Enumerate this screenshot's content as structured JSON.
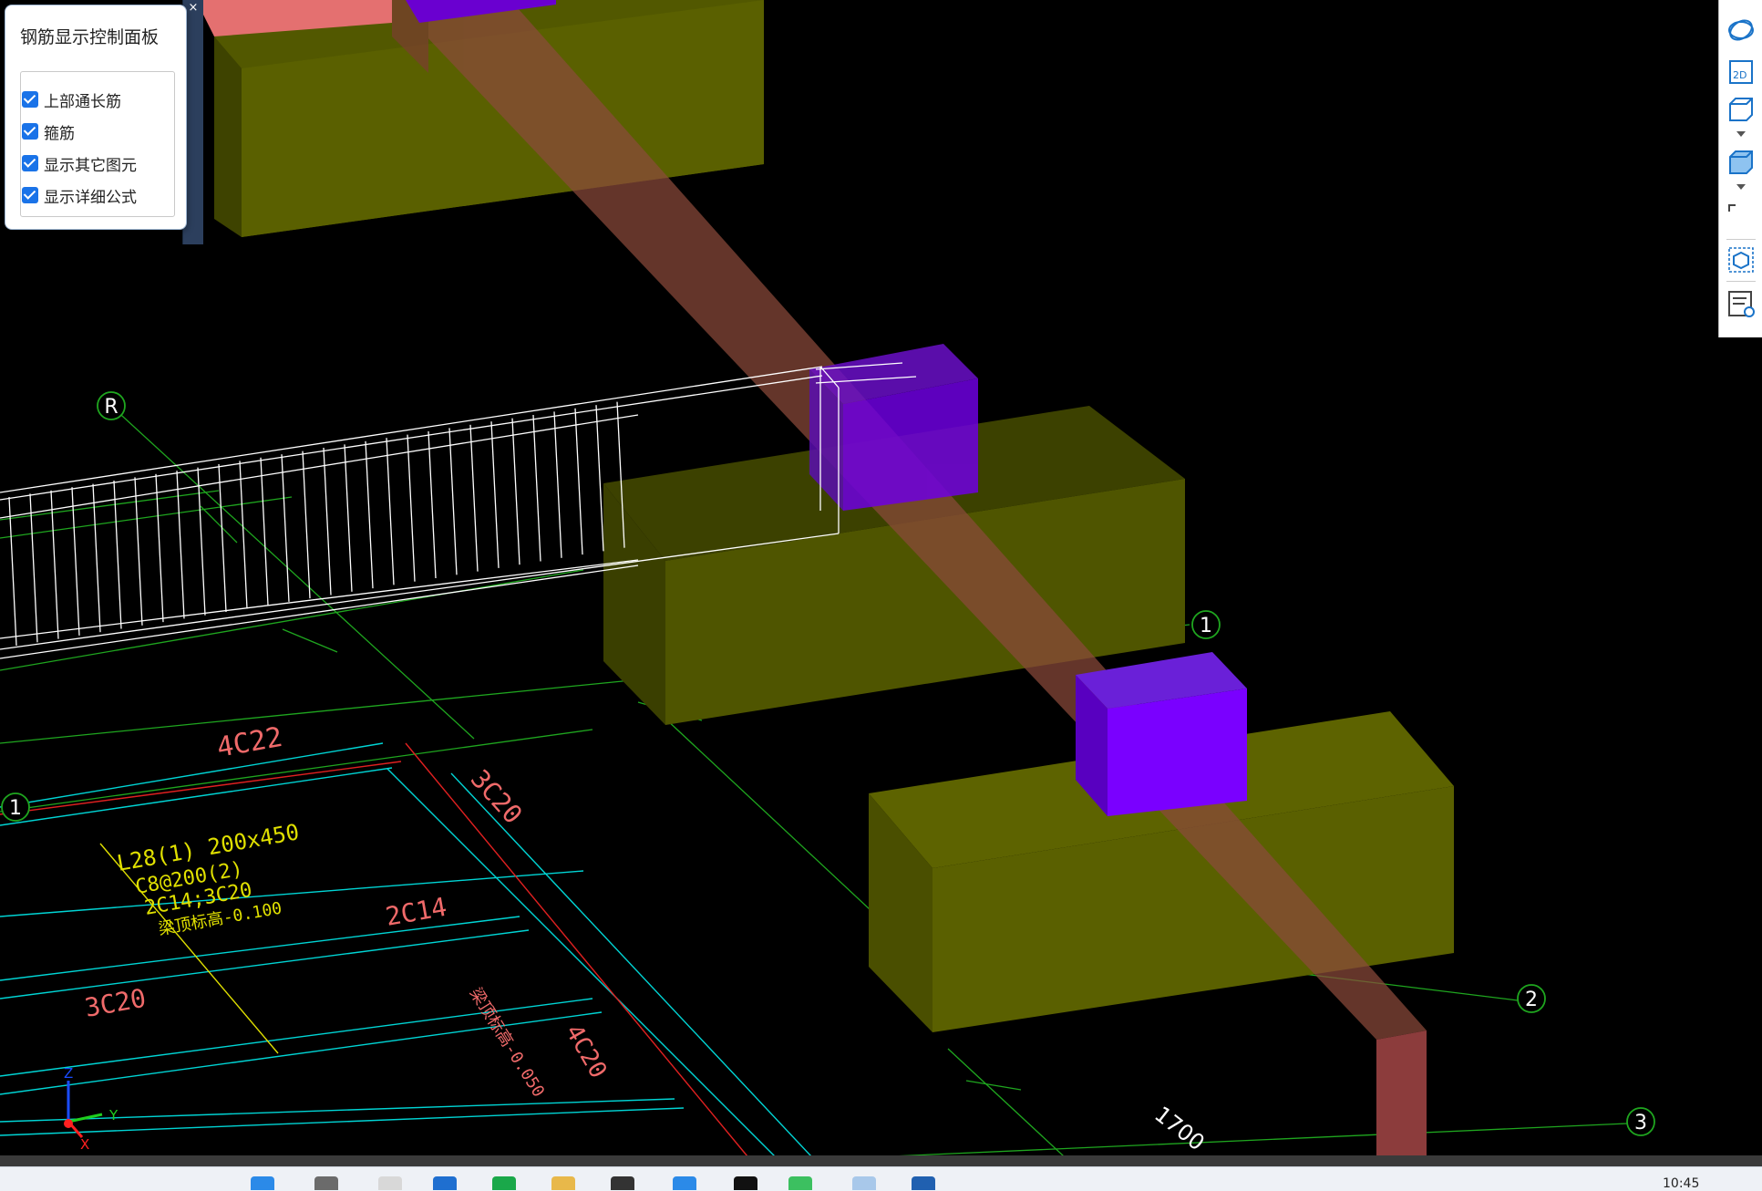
{
  "panel": {
    "title": "钢筋显示控制面板",
    "close_glyph": "×",
    "options": [
      {
        "label": "上部通长筋",
        "checked": true
      },
      {
        "label": "箍筋",
        "checked": true
      },
      {
        "label": "显示其它图元",
        "checked": true
      },
      {
        "label": "显示详细公式",
        "checked": true
      }
    ]
  },
  "axis_labels": {
    "r": "R",
    "one_top": "1",
    "one_left": "1",
    "two": "2",
    "three": "3",
    "dimension": "1700"
  },
  "annotations": {
    "rebar_4c22": "4C22",
    "rebar_3c20_top": "3C20",
    "beam_spec": "L28(1) 200x450",
    "stirrup_spec": "C8@200(2)",
    "long_bars": "2C14;3C20",
    "elevation": "梁顶标高-0.100",
    "rebar_2c14": "2C14",
    "rebar_3c20_bottom": "3C20",
    "rebar_4c20": "4C20",
    "elevation_side": "梁顶标高-0.050"
  },
  "gizmo": {
    "x": "X",
    "y": "Y",
    "z": "Z"
  },
  "taskbar": {
    "clock": "10:45"
  },
  "colors": {
    "background": "#000000",
    "grid_green": "#1fa61f",
    "cyan_line": "#00d5d5",
    "red_line": "#e02020",
    "salmon_text": "#f06a6a",
    "yellow_text": "#e0e000",
    "olive_block": "#5a6000",
    "purple_column": "#7a00ff",
    "beam_brown": "#8a4a3a"
  }
}
